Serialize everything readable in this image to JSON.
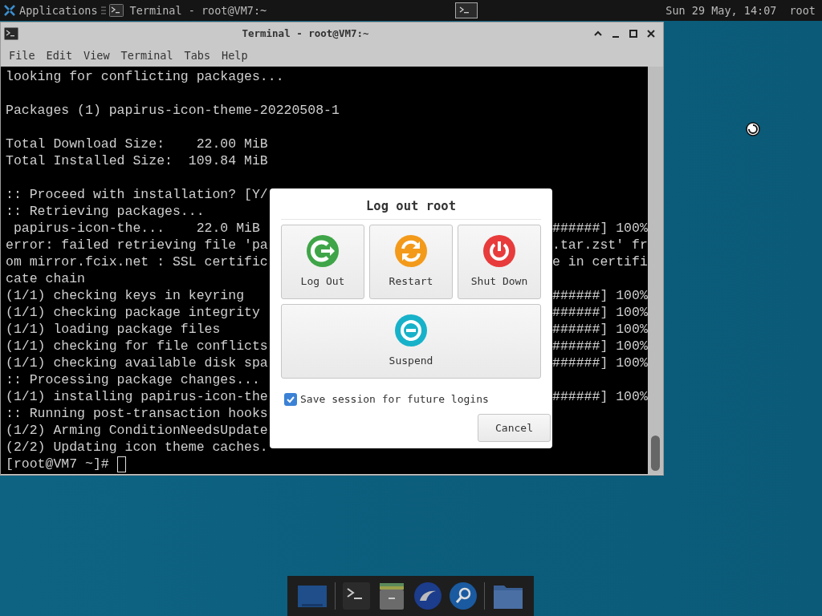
{
  "top_panel": {
    "applications_label": "Applications",
    "task": {
      "title": "Terminal - root@VM7:~"
    },
    "clock": "Sun 29 May, 14:07",
    "user": "root"
  },
  "terminal_window": {
    "title": "Terminal - root@VM7:~",
    "menu": [
      "File",
      "Edit",
      "View",
      "Terminal",
      "Tabs",
      "Help"
    ],
    "lines": [
      {
        "kind": "text",
        "left": "looking for conflicting packages..."
      },
      {
        "kind": "blank"
      },
      {
        "kind": "text",
        "left": "Packages (1) papirus-icon-theme-20220508-1"
      },
      {
        "kind": "blank"
      },
      {
        "kind": "text",
        "left": "Total Download Size:    22.00 MiB"
      },
      {
        "kind": "text",
        "left": "Total Installed Size:  109.84 MiB"
      },
      {
        "kind": "blank"
      },
      {
        "kind": "text",
        "left": ":: Proceed with installation? [Y/"
      },
      {
        "kind": "text",
        "left": ":: Retrieving packages..."
      },
      {
        "kind": "text",
        "left": " papirus-icon-the...    22.0 MiB",
        "right": "######] 100%"
      },
      {
        "kind": "text",
        "left": "error: failed retrieving file 'pa",
        "right": ".tar.zst' fr"
      },
      {
        "kind": "text",
        "left": "om mirror.fcix.net : SSL certific",
        "right": "e in certifi"
      },
      {
        "kind": "text",
        "left": "cate chain"
      },
      {
        "kind": "text",
        "left": "(1/1) checking keys in keyring",
        "right": "######] 100%"
      },
      {
        "kind": "text",
        "left": "(1/1) checking package integrity",
        "right": "######] 100%"
      },
      {
        "kind": "text",
        "left": "(1/1) loading package files",
        "right": "######] 100%"
      },
      {
        "kind": "text",
        "left": "(1/1) checking for file conflicts",
        "right": "######] 100%"
      },
      {
        "kind": "text",
        "left": "(1/1) checking available disk spa",
        "right": "######] 100%"
      },
      {
        "kind": "text",
        "left": ":: Processing package changes..."
      },
      {
        "kind": "text",
        "left": "(1/1) installing papirus-icon-the",
        "right": "######] 100%"
      },
      {
        "kind": "text",
        "left": ":: Running post-transaction hooks"
      },
      {
        "kind": "text",
        "left": "(1/2) Arming ConditionNeedsUpdate"
      },
      {
        "kind": "text",
        "left": "(2/2) Updating icon theme caches."
      }
    ],
    "prompt": "[root@VM7 ~]#"
  },
  "logout_dialog": {
    "title": "Log out root",
    "actions": [
      {
        "kind": "logout",
        "label": "Log Out"
      },
      {
        "kind": "restart",
        "label": "Restart"
      },
      {
        "kind": "shutdown",
        "label": "Shut Down"
      },
      {
        "kind": "suspend",
        "label": "Suspend"
      }
    ],
    "save_session": {
      "label": "Save session for future logins",
      "checked": true
    },
    "cancel": "Cancel"
  }
}
